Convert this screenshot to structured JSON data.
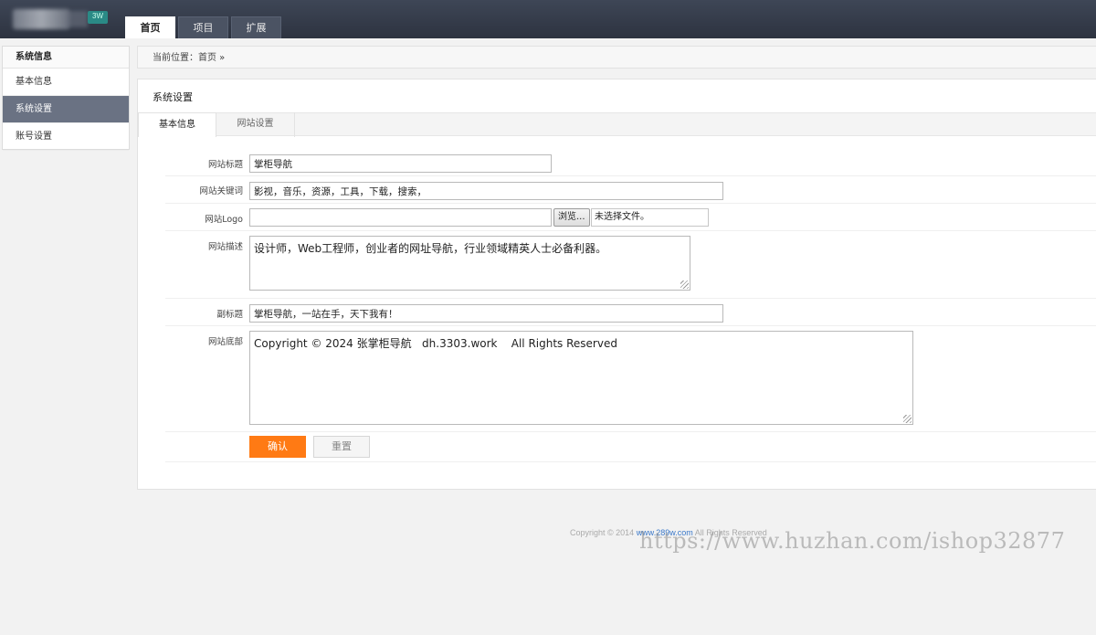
{
  "header": {
    "nav": [
      "首页",
      "项目",
      "扩展"
    ],
    "active_nav": 0
  },
  "sidebar": {
    "title": "系统信息",
    "items": [
      {
        "label": "基本信息"
      },
      {
        "label": "系统设置",
        "active": true
      },
      {
        "label": "账号设置"
      }
    ]
  },
  "breadcrumb": {
    "text": "当前位置：首页 »"
  },
  "panel": {
    "title": "系统设置",
    "tabs": [
      "基本信息",
      "网站设置"
    ],
    "active_tab": 0
  },
  "form": {
    "site_title": {
      "label": "网站标题",
      "value": "掌柜导航"
    },
    "keywords": {
      "label": "网站关键词",
      "value": "影视，音乐，资源，工具，下载，搜索，"
    },
    "logo": {
      "label": "网站Logo",
      "value": "",
      "browse_label": "浏览...",
      "no_file": "未选择文件。"
    },
    "description": {
      "label": "网站描述",
      "value": "设计师，Web工程师，创业者的网址导航，行业领域精英人士必备利器。"
    },
    "subtitle": {
      "label": "副标题",
      "value": "掌柜导航，一站在手，天下我有！"
    },
    "footer": {
      "label": "网站底部",
      "value": "Copyright © 2024 张掌柜导航   dh.3303.work    All Rights Reserved"
    },
    "submit_label": "确认",
    "reset_label": "重置"
  },
  "page_footer": {
    "prefix": "Copyright © 2014",
    "link": "www.289w.com",
    "suffix": "All Rights Reserved"
  },
  "watermark": "https://www.huzhan.com/ishop32877",
  "colors": {
    "topbar": "#3e4656",
    "sidebar_active": "#6a7283",
    "accent_button": "#ff7a14"
  }
}
